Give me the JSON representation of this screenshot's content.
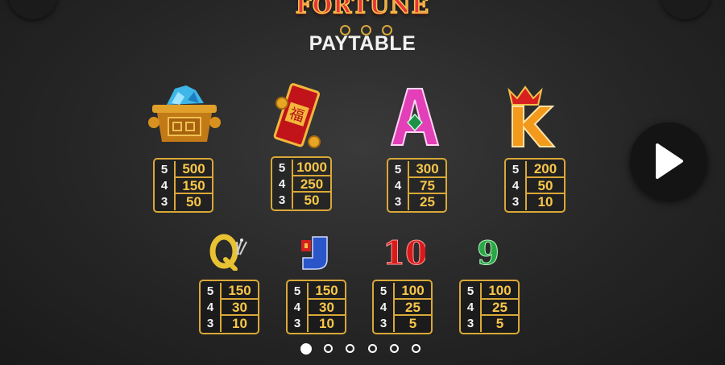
{
  "header": {
    "logo_text": "FORTUNE",
    "title": "PAYTABLE"
  },
  "controls": {
    "play_icon": "play-icon",
    "corner_left_icon": "close-icon",
    "corner_right_icon": "menu-icon"
  },
  "symbols": [
    {
      "name": "treasure-chest",
      "icon": "gold-ingot-with-gems",
      "rows": [
        {
          "count": "5",
          "pay": "500"
        },
        {
          "count": "4",
          "pay": "150"
        },
        {
          "count": "3",
          "pay": "50"
        }
      ]
    },
    {
      "name": "red-envelope",
      "icon": "red-envelope-with-coins",
      "glyph": "福",
      "rows": [
        {
          "count": "5",
          "pay": "1000"
        },
        {
          "count": "4",
          "pay": "250"
        },
        {
          "count": "3",
          "pay": "50"
        }
      ]
    },
    {
      "name": "letter-a",
      "icon": "A",
      "rows": [
        {
          "count": "5",
          "pay": "300"
        },
        {
          "count": "4",
          "pay": "75"
        },
        {
          "count": "3",
          "pay": "25"
        }
      ]
    },
    {
      "name": "letter-k",
      "icon": "K",
      "rows": [
        {
          "count": "5",
          "pay": "200"
        },
        {
          "count": "4",
          "pay": "50"
        },
        {
          "count": "3",
          "pay": "10"
        }
      ]
    },
    {
      "name": "letter-q",
      "icon": "Q",
      "rows": [
        {
          "count": "5",
          "pay": "150"
        },
        {
          "count": "4",
          "pay": "30"
        },
        {
          "count": "3",
          "pay": "10"
        }
      ]
    },
    {
      "name": "letter-j",
      "icon": "J",
      "rows": [
        {
          "count": "5",
          "pay": "150"
        },
        {
          "count": "4",
          "pay": "30"
        },
        {
          "count": "3",
          "pay": "10"
        }
      ]
    },
    {
      "name": "number-10",
      "icon": "10",
      "rows": [
        {
          "count": "5",
          "pay": "100"
        },
        {
          "count": "4",
          "pay": "25"
        },
        {
          "count": "3",
          "pay": "5"
        }
      ]
    },
    {
      "name": "number-9",
      "icon": "9",
      "rows": [
        {
          "count": "5",
          "pay": "100"
        },
        {
          "count": "4",
          "pay": "25"
        },
        {
          "count": "3",
          "pay": "5"
        }
      ]
    }
  ],
  "pagination": {
    "total": 6,
    "active": 0
  },
  "colors": {
    "gold": "#d9a838",
    "payout": "#f7c64a",
    "background": "#262626"
  }
}
